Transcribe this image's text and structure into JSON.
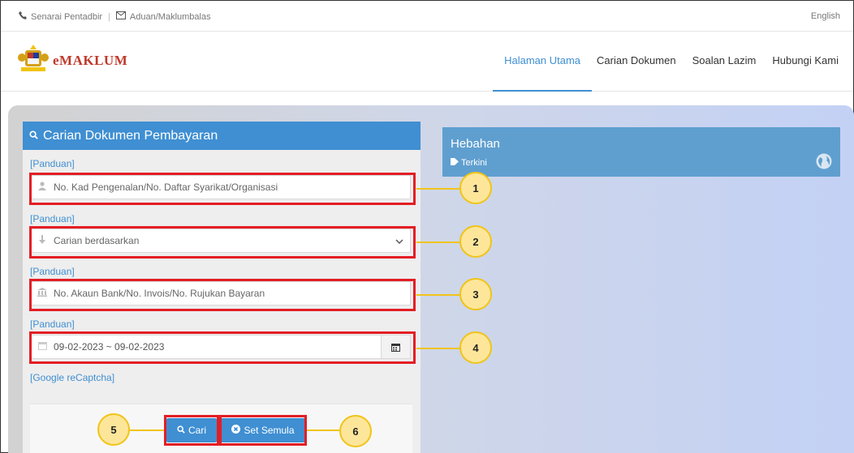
{
  "topbar": {
    "admin_list": "Senarai Pentadbir",
    "feedback": "Aduan/Maklumbalas",
    "language": "English"
  },
  "brand": {
    "name": "eMAKLUM"
  },
  "nav": {
    "items": [
      {
        "label": "Halaman Utama",
        "active": true
      },
      {
        "label": "Carian Dokumen",
        "active": false
      },
      {
        "label": "Soalan Lazim",
        "active": false
      },
      {
        "label": "Hubungi Kami",
        "active": false
      }
    ]
  },
  "search": {
    "title": "Carian Dokumen Pembayaran",
    "guide_label": "[Panduan]",
    "id_placeholder": "No. Kad Pengenalan/No. Daftar Syarikat/Organisasi",
    "search_by_placeholder": "Carian berdasarkan",
    "account_placeholder": "No. Akaun Bank/No. Invois/No. Rujukan Bayaran",
    "date_range": "09-02-2023 ~ 09-02-2023",
    "captcha_label": "[Google reCaptcha]",
    "search_button": "Cari",
    "reset_button": "Set Semula"
  },
  "news": {
    "title": "Hebahan",
    "subtitle": "Terkini"
  },
  "callouts": [
    "1",
    "2",
    "3",
    "4",
    "5",
    "6"
  ],
  "colors": {
    "primary": "#3f8fd2",
    "highlight": "#e31e24",
    "callout_fill": "#fde69a",
    "callout_border": "#f0c419"
  }
}
